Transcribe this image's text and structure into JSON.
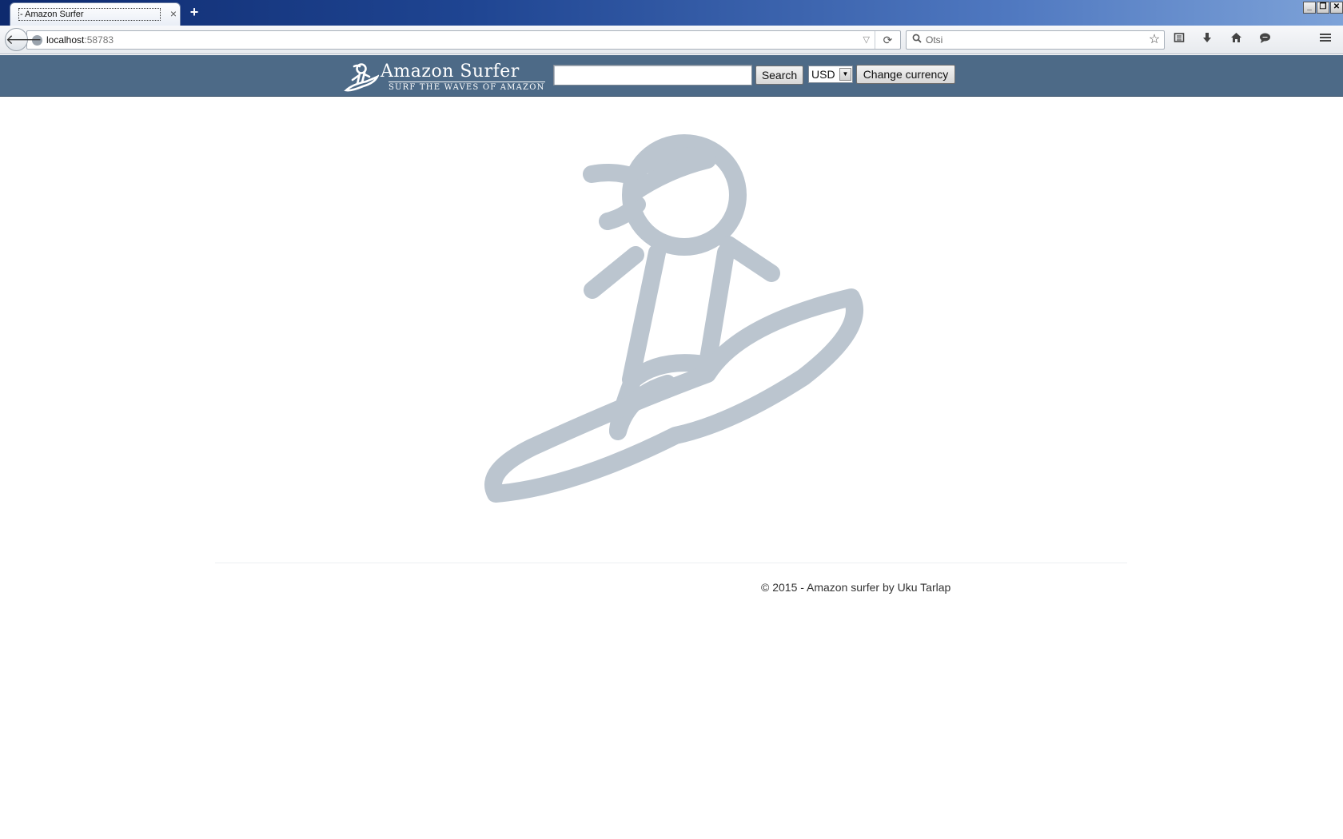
{
  "browser": {
    "tab_title": "- Amazon Surfer",
    "tab_close": "×",
    "new_tab": "+",
    "window_buttons": {
      "minimize": "_",
      "restore": "❐",
      "close": "✕"
    },
    "url_host": "localhost",
    "url_port": ":58783",
    "search_text": "Otsi",
    "icons": [
      "back-icon",
      "globe-icon",
      "reload-icon",
      "search-icon",
      "star-icon",
      "reading-list-icon",
      "download-icon",
      "home-icon",
      "chat-icon",
      "menu-icon"
    ]
  },
  "site": {
    "brand_color": "#4d6a87",
    "logo_title": "Amazon Surfer",
    "logo_tagline": "SURF THE WAVES OF AMAZON",
    "search_button": "Search",
    "search_placeholder": "",
    "currency_selected": "USD",
    "change_currency_button": "Change currency",
    "hero_image": "surfer-illustration",
    "hero_color": "#bbc5cf",
    "footer": "© 2015 - Amazon surfer by Uku Tarlap"
  }
}
